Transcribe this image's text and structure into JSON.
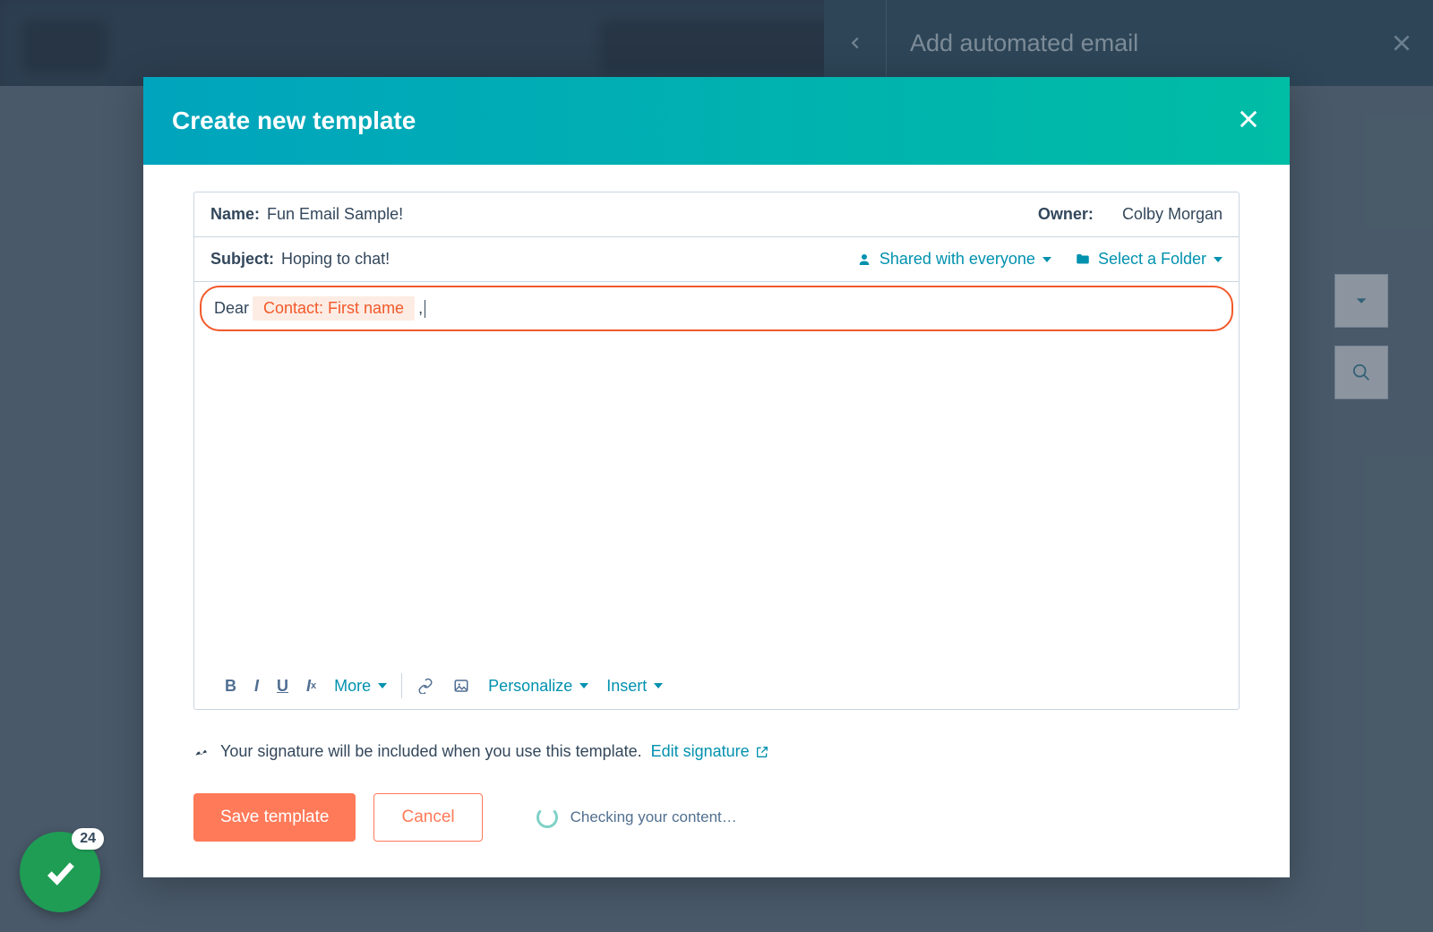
{
  "secondary_panel": {
    "title": "Add automated email"
  },
  "modal": {
    "title": "Create new template",
    "name_label": "Name:",
    "name_value": "Fun Email Sample!",
    "owner_label": "Owner:",
    "owner_value": "Colby Morgan",
    "subject_label": "Subject:",
    "subject_value": "Hoping to chat!",
    "share_label": "Shared with everyone",
    "folder_label": "Select a Folder",
    "body": {
      "prefix": "Dear ",
      "token": "Contact: First name",
      "suffix": ","
    },
    "toolbar": {
      "more": "More",
      "personalize": "Personalize",
      "insert": "Insert"
    },
    "signature_text": "Your signature will be included when you use this template.",
    "signature_link": "Edit signature",
    "save_label": "Save template",
    "cancel_label": "Cancel",
    "checking_text": "Checking your content…"
  },
  "badge": {
    "count": "24"
  }
}
